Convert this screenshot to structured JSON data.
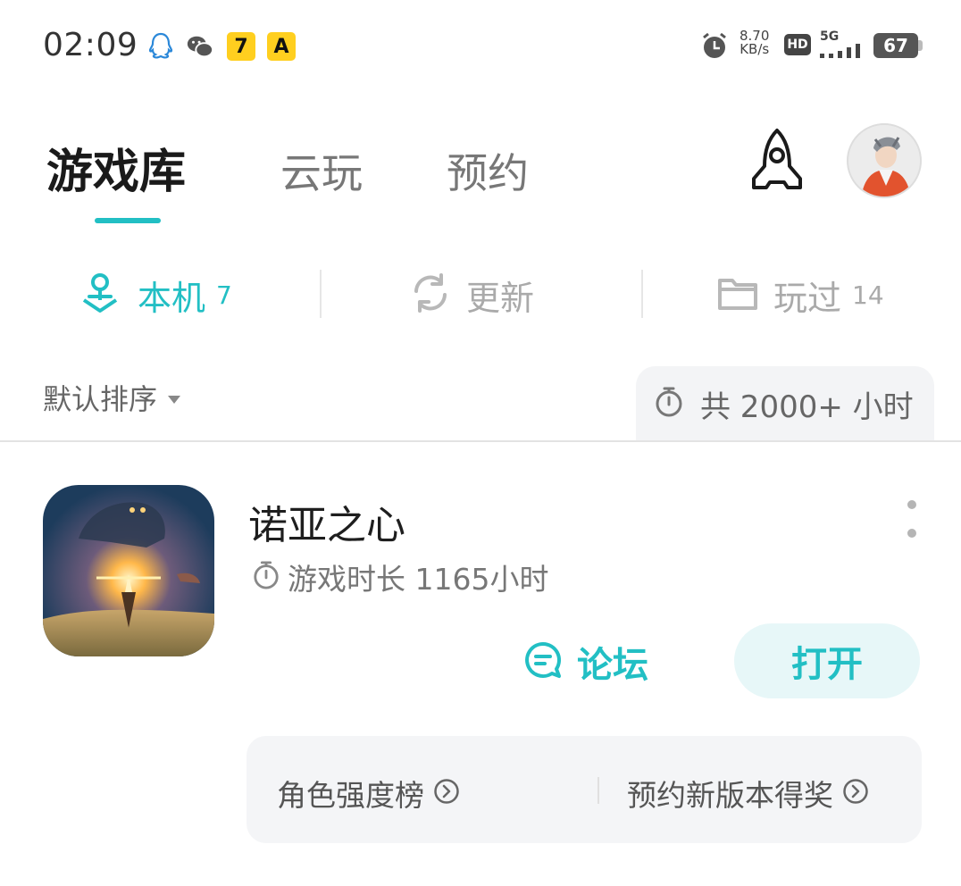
{
  "status_bar": {
    "time": "02:09",
    "net_speed_value": "8.70",
    "net_speed_unit": "KB/s",
    "hd_label": "HD",
    "signal_label": "5G",
    "battery": "67",
    "icons": [
      "qq-icon",
      "wechat-icon",
      "app-7-icon",
      "app-a-icon",
      "alarm-icon",
      "signal-icon",
      "battery-icon"
    ],
    "app_badge_7": "7",
    "app_badge_a": "A"
  },
  "top_tabs": [
    {
      "label": "游戏库",
      "active": true
    },
    {
      "label": "云玩",
      "active": false
    },
    {
      "label": "预约",
      "active": false
    }
  ],
  "sub_tabs": [
    {
      "label": "本机",
      "count": "7",
      "icon": "location-icon",
      "active": true
    },
    {
      "label": "更新",
      "count": "",
      "icon": "refresh-icon",
      "active": false
    },
    {
      "label": "玩过",
      "count": "14",
      "icon": "folder-icon",
      "active": false
    }
  ],
  "sort": {
    "label": "默认排序"
  },
  "total_time": {
    "label": "共 2000+ 小时",
    "icon": "timer-icon"
  },
  "game": {
    "title": "诺亚之心",
    "playtime": "游戏时长 1165小时",
    "forum_label": "论坛",
    "open_label": "打开"
  },
  "quick_links": [
    {
      "label": "角色强度榜"
    },
    {
      "label": "预约新版本得奖"
    }
  ],
  "colors": {
    "accent": "#22bfc4",
    "muted": "#aaaaaa",
    "panel": "#f4f5f7"
  }
}
